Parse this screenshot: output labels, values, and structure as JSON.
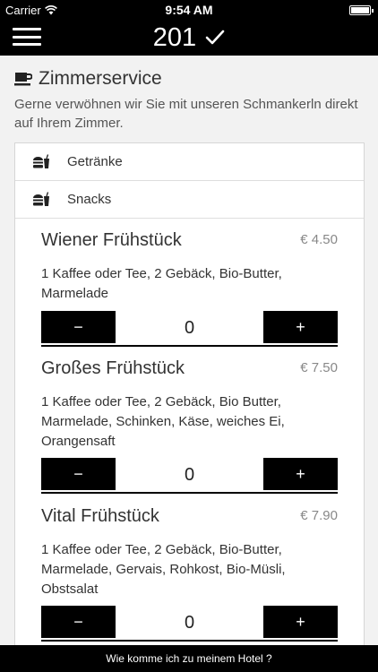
{
  "status_bar": {
    "carrier": "Carrier",
    "time": "9:54 AM"
  },
  "nav": {
    "room_number": "201"
  },
  "section": {
    "title": "Zimmerservice",
    "intro": "Gerne verwöhnen wir Sie mit unseren Schmankerln direkt auf Ihrem Zimmer."
  },
  "categories": [
    {
      "label": "Getränke",
      "icon": "food-drink-icon"
    },
    {
      "label": "Snacks",
      "icon": "food-drink-icon"
    }
  ],
  "products": [
    {
      "name": "Wiener Frühstück",
      "price": "€ 4.50",
      "description": "1 Kaffee oder Tee, 2 Gebäck, Bio-Butter, Marmelade",
      "quantity": "0",
      "minus_label": "−",
      "plus_label": "+"
    },
    {
      "name": "Großes Frühstück",
      "price": "€ 7.50",
      "description": "1 Kaffee oder Tee, 2 Gebäck, Bio Butter, Marmelade, Schinken, Käse, weiches Ei, Orangensaft",
      "quantity": "0",
      "minus_label": "−",
      "plus_label": "+"
    },
    {
      "name": "Vital Frühstück",
      "price": "€ 7.90",
      "description": "1 Kaffee oder Tee, 2 Gebäck, Bio-Butter, Marmelade, Gervais, Rohkost, Bio-Müsli, Obstsalat",
      "quantity": "0",
      "minus_label": "−",
      "plus_label": "+"
    }
  ],
  "footer": {
    "link_label": "Wie komme ich zu meinem Hotel ?"
  },
  "colors": {
    "bar_background": "#000000",
    "page_background": "#f2f2f2",
    "panel_background": "#ffffff",
    "price_text": "#888888"
  }
}
